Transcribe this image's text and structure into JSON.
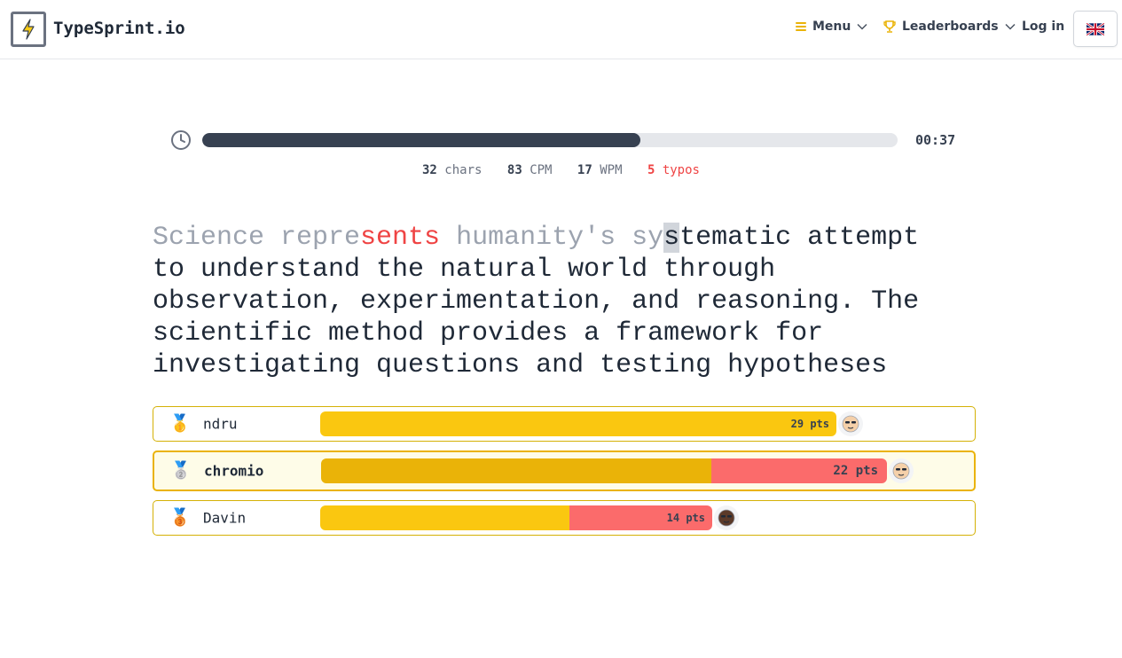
{
  "header": {
    "brand": "TypeSprint.io",
    "nav": {
      "menu_label": "Menu",
      "leaderboards_label": "Leaderboards",
      "login_label": "Log in"
    },
    "language_icon": "uk-flag-icon"
  },
  "timer": {
    "time": "00:37",
    "progress_fraction": 0.63
  },
  "stats": {
    "chars_value": "32",
    "chars_label": "chars",
    "cpm_value": "83",
    "cpm_label": "CPM",
    "wpm_value": "17",
    "wpm_label": "WPM",
    "typos_value": "5",
    "typos_label": "typos"
  },
  "text": {
    "typed_before_error": "Science repre",
    "error_part": "sents",
    "typed_after_error": " humanity's sy",
    "cursor_char": "s",
    "remaining": "tematic attempt to understand the natural world through observation, experimentation, and reasoning. The scientific method provides a framework for investigating questions and testing hypotheses"
  },
  "race": [
    {
      "rank_icon": "gold-medal-icon",
      "name": "ndru",
      "points": "29 pts",
      "progress": 0.685,
      "error_fraction": 0.0,
      "is_me": false
    },
    {
      "rank_icon": "silver-medal-icon",
      "name": "chromio",
      "points": "22 pts",
      "progress": 0.75,
      "error_fraction": 0.31,
      "is_me": true
    },
    {
      "rank_icon": "bronze-medal-icon",
      "name": "Davin",
      "points": "14 pts",
      "progress": 0.52,
      "error_fraction": 0.365,
      "is_me": false
    }
  ],
  "colors": {
    "accent_yellow": "#fac710",
    "error_red": "#ef4444",
    "progress_dark": "#374151"
  }
}
